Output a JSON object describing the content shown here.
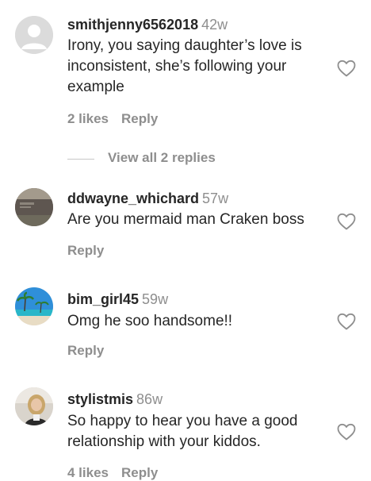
{
  "comments": [
    {
      "username": "smithjenny6562018",
      "time": "42w",
      "text": "Irony, you saying daughter’s love is inconsistent, she’s following your example",
      "likes": "2 likes",
      "reply": "Reply"
    },
    {
      "username": "ddwayne_whichard",
      "time": "57w",
      "text": "Are you mermaid man Craken boss",
      "reply": "Reply"
    },
    {
      "username": "bim_girl45",
      "time": "59w",
      "text": "Omg he soo handsome!!",
      "reply": "Reply"
    },
    {
      "username": "stylistmis",
      "time": "86w",
      "text": "So happy to hear you have a good relationship with your kiddos.",
      "likes": "4 likes",
      "reply": "Reply"
    }
  ],
  "view_replies": "View all 2 replies",
  "icons": {
    "heart": "heart-outline-icon",
    "default_avatar": "default-avatar-icon"
  },
  "colors": {
    "text": "#262626",
    "secondary": "#8e8e8e",
    "divider": "#c7c7c7"
  }
}
